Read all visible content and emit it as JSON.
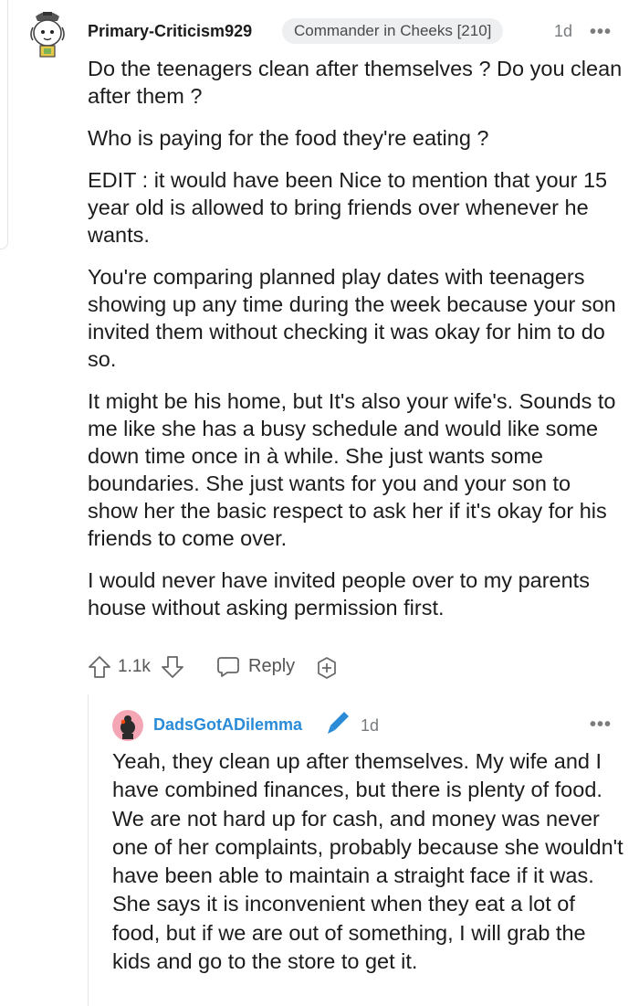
{
  "comment": {
    "author": "Primary-Criticism929",
    "flair": "Commander in Cheeks [210]",
    "time": "1d",
    "more": "•••",
    "paragraphs": [
      "Do the teenagers clean after themselves ? Do you clean after them ?",
      "Who is paying for the food they're eating ?",
      "EDIT : it would have been Nice to mention that your 15 year old is allowed to bring friends over whenever he wants.",
      "You're comparing planned play dates with teenagers showing up any time during the week because your son invited them without checking it was okay for him to do so.",
      "It might be his home, but It's also your wife's. Sounds to me like she has a busy schedule and would like some down time once in à while. She just wants some boundaries. She just wants for you and your son to show her the basic respect to ask her if it's okay for his friends to come over.",
      "I would never have invited people over to my parents house without asking permission first."
    ],
    "score": "1.1k",
    "reply_label": "Reply"
  },
  "reply": {
    "author": "DadsGotADilemma",
    "time": "1d",
    "more": "•••",
    "paragraphs": [
      "Yeah, they clean up after themselves. My wife and I have combined finances, but there is plenty of food. We are not hard up for cash, and money was never one of her complaints, probably because she wouldn't have been able to maintain a straight face if it was. She says it is inconvenient when they eat a lot of food, but if we are out of something, I will grab the kids and go to the store to get it."
    ]
  },
  "colors": {
    "reply_author": "#2a8bd8",
    "flair_bg": "#edeff1",
    "avatar2_bg": "#f4a6b5"
  },
  "icons": {
    "upvote": "upvote-icon",
    "downvote": "downvote-icon",
    "reply": "reply-icon",
    "award": "award-icon",
    "pencil": "pencil-icon"
  }
}
